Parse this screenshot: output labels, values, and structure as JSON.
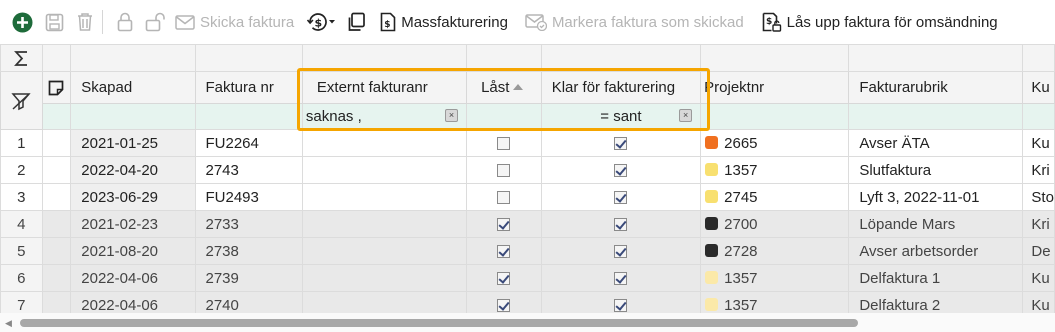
{
  "toolbar": {
    "send_invoice": "Skicka faktura",
    "mass_invoicing": "Massfakturering",
    "mark_sent": "Markera faktura som skickad",
    "unlock_resend": "Lås upp faktura för omsändning"
  },
  "columns": {
    "created": "Skapad",
    "invoice_no": "Faktura nr",
    "external_no": "Externt fakturanr",
    "locked": "Låst",
    "ready": "Klar för fakturering",
    "project": "Projektnr",
    "heading": "Fakturarubrik",
    "customer": "Ku"
  },
  "filters": {
    "external_no": "saknas ,",
    "ready": "= sant"
  },
  "rows": [
    {
      "num": "1",
      "created": "2021-01-25",
      "invoice_no": "FU2264",
      "locked": false,
      "ready": true,
      "color": "#f07020",
      "project": "2665",
      "heading": "Avser ÄTA",
      "customer": "Ku"
    },
    {
      "num": "2",
      "created": "2022-04-20",
      "invoice_no": "2743",
      "locked": false,
      "ready": true,
      "color": "#f8e070",
      "project": "1357",
      "heading": "Slutfaktura",
      "customer": "Kri"
    },
    {
      "num": "3",
      "created": "2023-06-29",
      "invoice_no": "FU2493",
      "locked": false,
      "ready": true,
      "color": "#f8e070",
      "project": "2745",
      "heading": "Lyft 3, 2022-11-01",
      "customer": "Sto"
    },
    {
      "num": "4",
      "created": "2021-02-23",
      "invoice_no": "2733",
      "locked": true,
      "ready": true,
      "color": "#2a2a2a",
      "project": "2700",
      "heading": "Löpande Mars",
      "customer": "Kri"
    },
    {
      "num": "5",
      "created": "2021-08-20",
      "invoice_no": "2738",
      "locked": true,
      "ready": true,
      "color": "#2a2a2a",
      "project": "2728",
      "heading": "Avser arbetsorder",
      "customer": "De"
    },
    {
      "num": "6",
      "created": "2022-04-06",
      "invoice_no": "2739",
      "locked": true,
      "ready": true,
      "color": "#fbe9a8",
      "project": "1357",
      "heading": "Delfaktura 1",
      "customer": "Ku"
    },
    {
      "num": "7",
      "created": "2022-04-06",
      "invoice_no": "2740",
      "locked": true,
      "ready": true,
      "color": "#fbe9a8",
      "project": "1357",
      "heading": "Delfaktura 2",
      "customer": "Ku"
    }
  ]
}
